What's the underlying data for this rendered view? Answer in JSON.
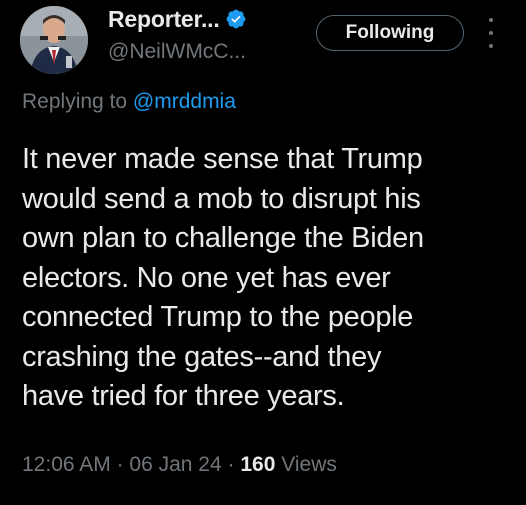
{
  "author": {
    "display_name": "Reporter...",
    "handle": "@NeilWMcC...",
    "verified": true,
    "verified_color": "#1d9bf0"
  },
  "follow_button": {
    "label": "Following"
  },
  "reply": {
    "prefix": "Replying to",
    "mention": "@mrddmia"
  },
  "tweet": {
    "lines": [
      "It never made sense that Trump",
      "would send a mob to disrupt his",
      "own plan to challenge the Biden",
      "electors. No one yet has ever",
      "connected Trump to the people",
      "crashing the gates--and they",
      "have tried for three years."
    ]
  },
  "meta": {
    "time": "12:06 AM",
    "separator": "·",
    "date": "06 Jan 24",
    "views_count": "160",
    "views_label": "Views"
  },
  "colors": {
    "background": "#000000",
    "text_primary": "#e7e9ea",
    "text_secondary": "#71767b",
    "link": "#1d9bf0",
    "button_border": "#536471"
  },
  "icons": {
    "verified": "verified-badge-icon",
    "more": "more-options-icon"
  }
}
